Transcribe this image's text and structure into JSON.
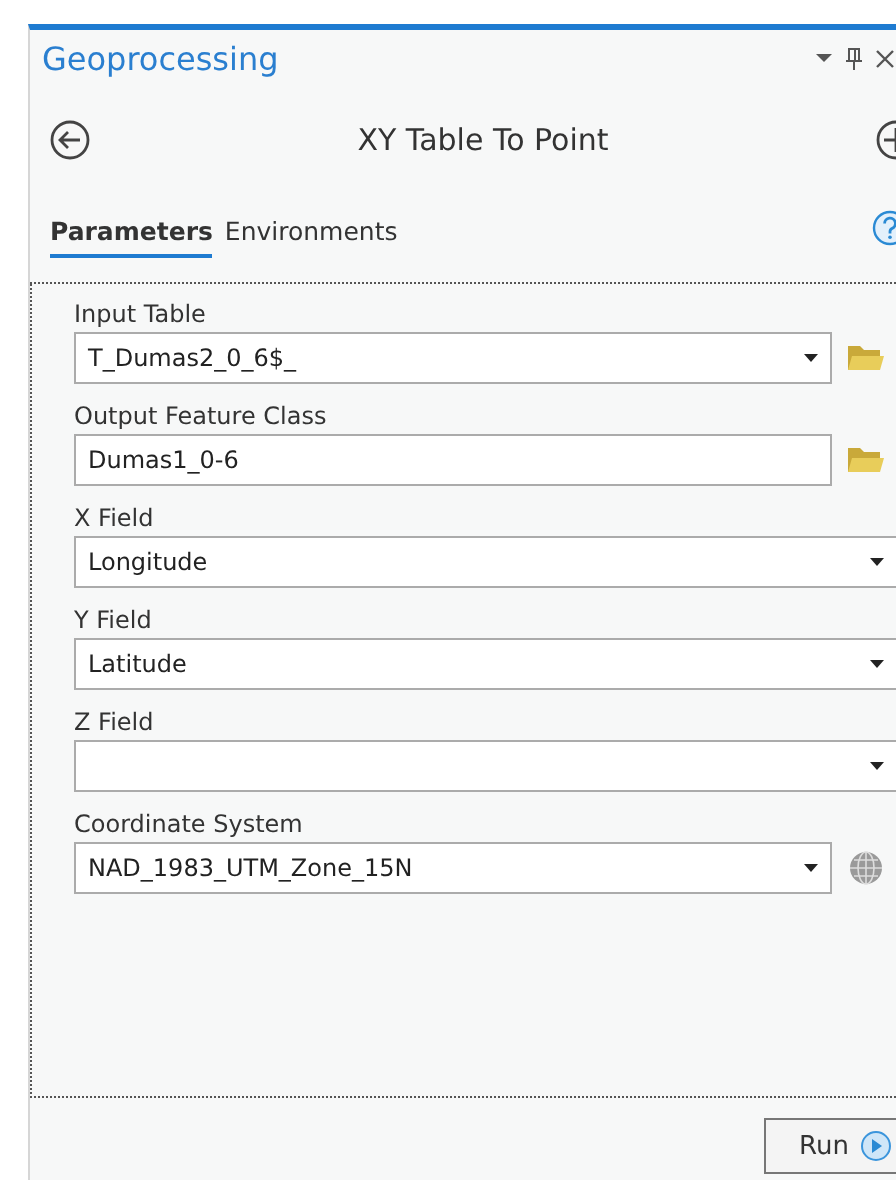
{
  "pane": {
    "title": "Geoprocessing"
  },
  "tool": {
    "title": "XY Table To Point"
  },
  "tabs": [
    {
      "label": "Parameters",
      "selected": true
    },
    {
      "label": "Environments",
      "selected": false
    }
  ],
  "fields": [
    {
      "label": "Input Table",
      "value": "T_Dumas2_0_6$_",
      "kind": "dropdown-browse"
    },
    {
      "label": "Output Feature Class",
      "value": "Dumas1_0-6",
      "kind": "text-browse"
    },
    {
      "label": "X Field",
      "value": "Longitude",
      "kind": "dropdown"
    },
    {
      "label": "Y Field",
      "value": "Latitude",
      "kind": "dropdown"
    },
    {
      "label": "Z Field",
      "kind": "dropdown"
    },
    {
      "label": "Coordinate System",
      "value": "NAD_1983_UTM_Zone_15N",
      "kind": "dropdown-coordinate"
    }
  ],
  "run_button": "Run"
}
